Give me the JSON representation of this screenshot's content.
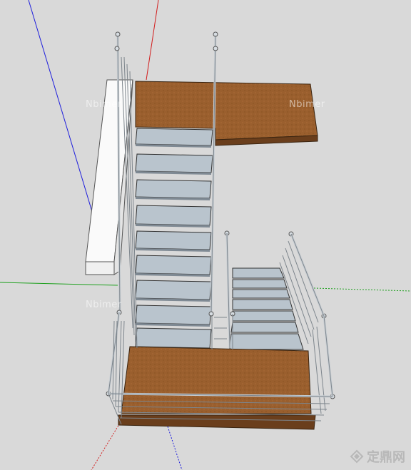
{
  "scene": {
    "colors": {
      "background": "#d9d9d9",
      "wood": "#9a5f2e",
      "wood_edge": "#6a3e1c",
      "step": "#b9c4cd",
      "step_shadow": "#7f8a94",
      "wall": "#fafafa",
      "rail": "#c8ced3",
      "rail_dark": "#7d858c",
      "axis_red": "#d21e1e",
      "axis_green": "#1da01d",
      "axis_blue": "#1e1edc"
    }
  },
  "watermarks": [
    "Nbimer",
    "Nbimer",
    "Nbimer"
  ],
  "logo": {
    "text": "定鼎网",
    "icon": "logo-mark-icon"
  }
}
